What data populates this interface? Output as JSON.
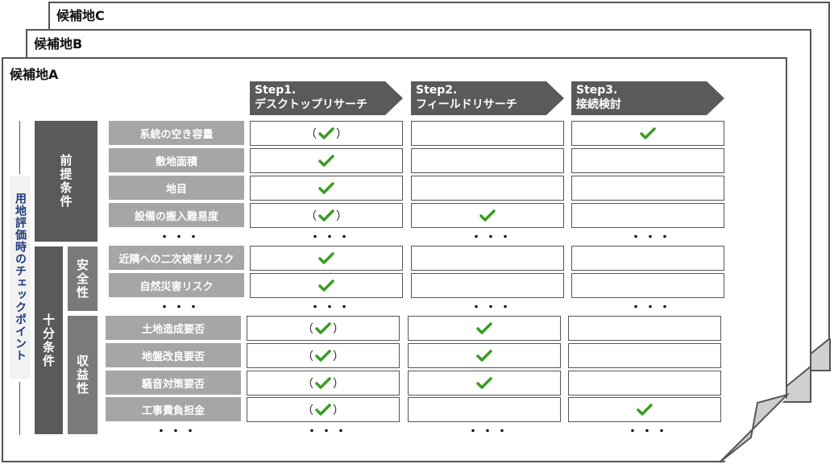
{
  "sites": [
    "候補地C",
    "候補地B",
    "候補地A"
  ],
  "steps": [
    {
      "line1": "Step1.",
      "line2": "デスクトップリサーチ"
    },
    {
      "line1": "Step2.",
      "line2": "フィールドリサーチ"
    },
    {
      "line1": "Step3.",
      "line2": "接続検討"
    }
  ],
  "side_label": "用地評価時のチェックポイント",
  "groups": {
    "precondition": "前提条件",
    "sufficient": "十分条件",
    "safety": "安全性",
    "profitability": "収益性"
  },
  "ellipsis": "・・・",
  "check_symbol": "✔",
  "paren_open": "（",
  "paren_close": "）",
  "colors": {
    "check": "#3a9d23",
    "dark_gray": "#5a5a5a",
    "light_gray": "#a6a6a6",
    "side_text": "#1f3b7a"
  },
  "rows": [
    {
      "label": "系統の空き容量",
      "cells": [
        "paren",
        "",
        "check"
      ]
    },
    {
      "label": "敷地面積",
      "cells": [
        "check",
        "",
        ""
      ]
    },
    {
      "label": "地目",
      "cells": [
        "check",
        "",
        ""
      ]
    },
    {
      "label": "設備の搬入難易度",
      "cells": [
        "paren",
        "check",
        ""
      ]
    },
    {
      "label": "近隣への二次被害リスク",
      "cells": [
        "check",
        "",
        ""
      ]
    },
    {
      "label": "自然災害リスク",
      "cells": [
        "check",
        "",
        ""
      ]
    },
    {
      "label": "土地造成要否",
      "cells": [
        "paren",
        "check",
        ""
      ]
    },
    {
      "label": "地盤改良要否",
      "cells": [
        "paren",
        "check",
        ""
      ]
    },
    {
      "label": "騒音対策要否",
      "cells": [
        "paren",
        "check",
        ""
      ]
    },
    {
      "label": "工事費負担金",
      "cells": [
        "paren",
        "",
        "check"
      ]
    }
  ]
}
